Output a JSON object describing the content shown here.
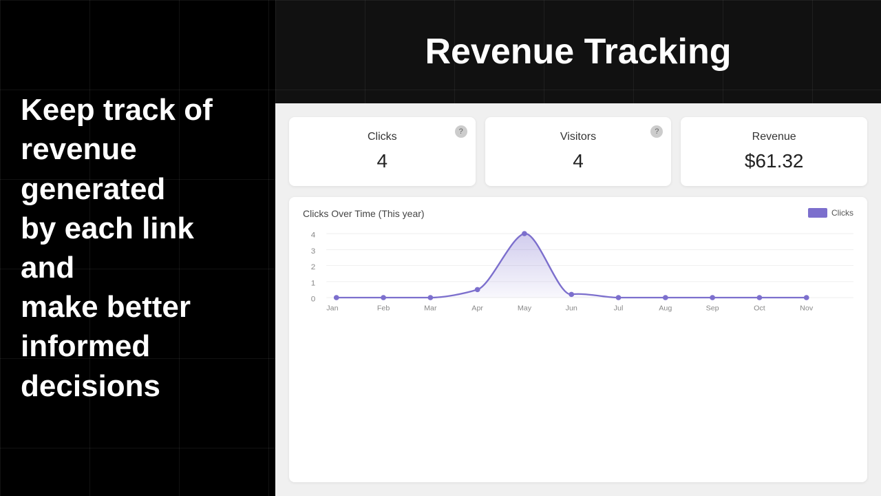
{
  "left": {
    "text_lines": [
      "Keep track of",
      "revenue generated",
      "by each link and",
      "make better",
      "informed decisions"
    ]
  },
  "header": {
    "title": "Revenue Tracking"
  },
  "stats": {
    "cards": [
      {
        "id": "clicks",
        "label": "Clicks",
        "value": "4"
      },
      {
        "id": "visitors",
        "label": "Visitors",
        "value": "4"
      },
      {
        "id": "revenue",
        "label": "Revenue",
        "value": "$61.32"
      }
    ]
  },
  "chart": {
    "title": "Clicks Over Time (This year)",
    "legend_label": "Clicks",
    "months": [
      "Jan",
      "Feb",
      "Mar",
      "Apr",
      "May",
      "Jun",
      "Jul",
      "Aug",
      "Sep",
      "Oct",
      "Nov"
    ],
    "y_labels": [
      "4",
      "3",
      "2",
      "1",
      "0"
    ],
    "data_points": [
      0,
      0,
      0,
      0.5,
      4,
      0.2,
      0,
      0,
      0,
      0,
      0
    ]
  },
  "colors": {
    "accent_purple": "#7c6fcd",
    "dark_bg": "#000",
    "light_bg": "#f0f0f0",
    "card_bg": "#ffffff"
  }
}
